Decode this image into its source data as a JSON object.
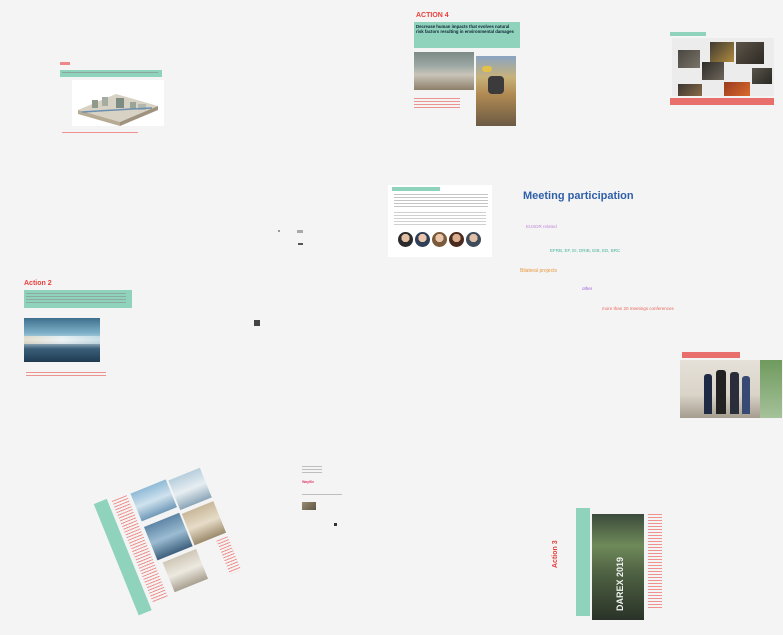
{
  "action4": {
    "title": "ACTION 4",
    "subtitle": "Decrease human impacts that evolves natural risk factors resulting in environmental damages"
  },
  "action2": {
    "title": "Action 2"
  },
  "action3": {
    "title": "Action 3",
    "book_title": "DAREX 2019"
  },
  "meeting": {
    "title": "Meeting participation",
    "lines": [
      "EUSDR related",
      "EFRB, EF, EI, DRIB, EIB, ED, BRC",
      "Bilateral projects",
      "other",
      "more than 20 meetings conferences"
    ]
  },
  "misc": {
    "pink_label": "Wayfile"
  },
  "colors": {
    "accent_red": "#e8413c",
    "accent_pink": "#e23b6b",
    "teal": "#8fd3bd",
    "meeting_blue": "#2f5fa8",
    "meeting_orange": "#e8983f",
    "meeting_teal": "#48b39b",
    "meeting_purple": "#9b5bd6",
    "meeting_lilac": "#c08ad8",
    "meeting_red": "#e86a5c"
  }
}
